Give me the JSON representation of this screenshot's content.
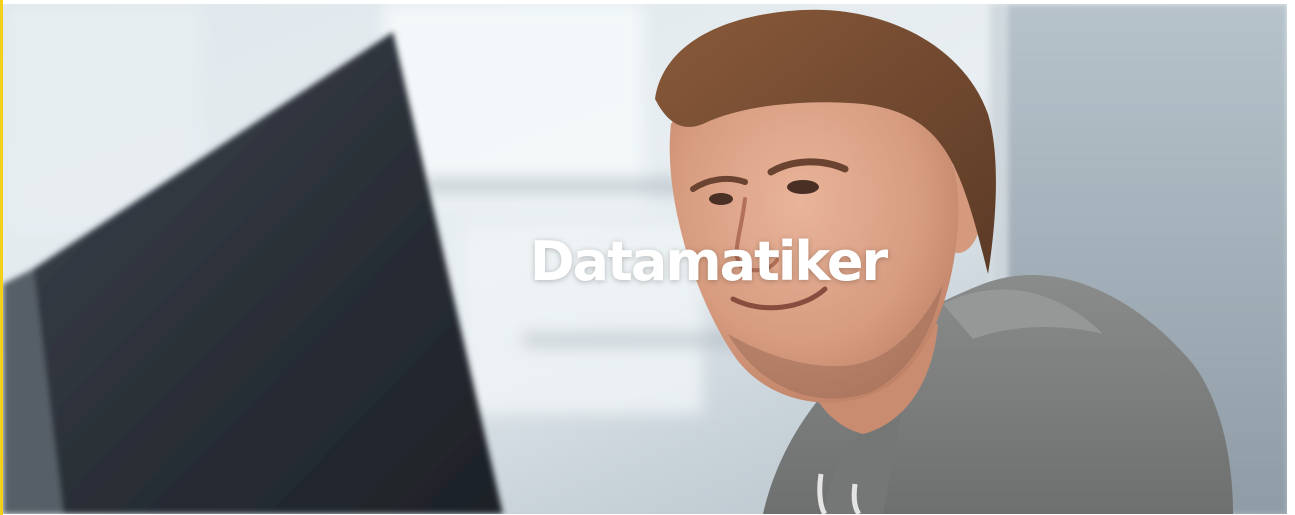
{
  "hero": {
    "title": "Datamatiker",
    "image_description_icon": "hero-photo",
    "title_color": "#ffffff"
  },
  "colors": {
    "accent": "#f3d11a",
    "background": "#ffffff"
  }
}
